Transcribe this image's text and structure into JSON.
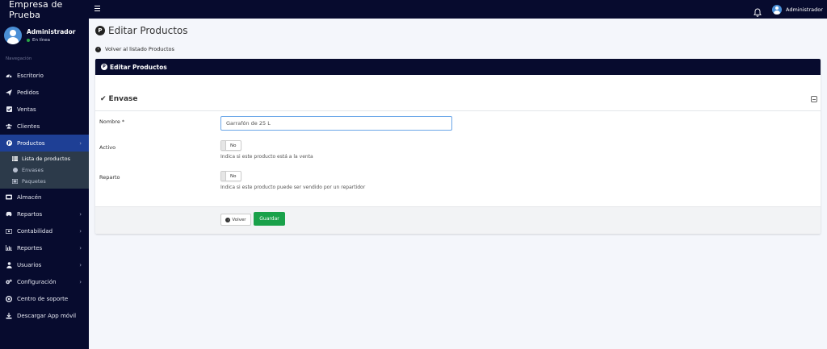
{
  "brand": {
    "name": "Empresa de Prueba"
  },
  "user": {
    "name": "Administrador",
    "status": "En línea"
  },
  "sidebar": {
    "header": "Navegación",
    "items": [
      {
        "label": "Escritorio",
        "icon": "tachometer-icon"
      },
      {
        "label": "Pedidos",
        "icon": "paper-plane-icon"
      },
      {
        "label": "Ventas",
        "icon": "check-square-icon"
      },
      {
        "label": "Clientes",
        "icon": "users-icon"
      },
      {
        "label": "Productos",
        "icon": "product-icon",
        "active": true,
        "expanded": true
      },
      {
        "label": "Almacén",
        "icon": "warehouse-icon"
      },
      {
        "label": "Repartos",
        "icon": "truck-icon"
      },
      {
        "label": "Contabilidad",
        "icon": "money-icon"
      },
      {
        "label": "Reportes",
        "icon": "bar-chart-icon"
      },
      {
        "label": "Usuarios",
        "icon": "user-icon"
      },
      {
        "label": "Configuración",
        "icon": "cogs-icon"
      },
      {
        "label": "Centro de soporte",
        "icon": "life-ring-icon"
      },
      {
        "label": "Descargar App móvil",
        "icon": "download-icon"
      }
    ],
    "subitems": [
      {
        "label": "Lista de productos",
        "active": true
      },
      {
        "label": "Envases"
      },
      {
        "label": "Paquetes"
      }
    ]
  },
  "topbar": {
    "user_name": "Administrador"
  },
  "page": {
    "title": "Editar Productos",
    "back_link": "Volver al listado Productos",
    "card_title": "Editar Productos",
    "section_title": "Envase"
  },
  "form": {
    "name_label": "Nombre *",
    "name_value": "Garrafón de 25 L",
    "active_label": "Activo",
    "active_value": "No",
    "active_help": "Indica si este producto está a la venta",
    "delivery_label": "Reparto",
    "delivery_value": "No",
    "delivery_help": "Indica si este producto puede ser vendido por un repartidor"
  },
  "buttons": {
    "back": "Volver",
    "save": "Guardar"
  },
  "colors": {
    "navy": "#070b2e",
    "active_blue": "#1e3f95",
    "success": "#1aa14a",
    "submenu": "#2c3a4a"
  }
}
